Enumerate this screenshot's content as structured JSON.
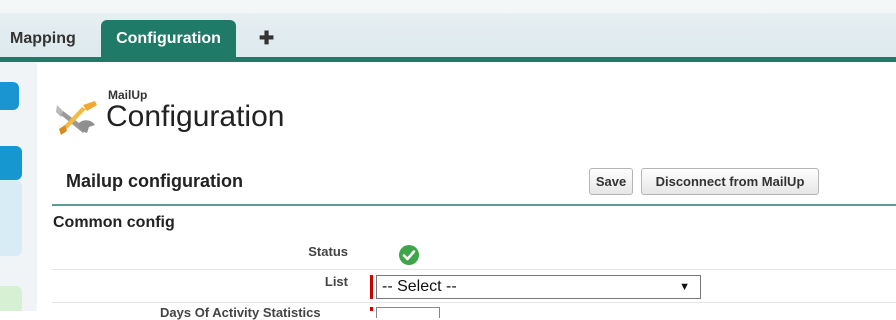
{
  "tabs": [
    {
      "label": "Mapping",
      "active": false
    },
    {
      "label": "Configuration",
      "active": true
    }
  ],
  "add_tab_symbol": "✚",
  "header": {
    "brand": "MailUp",
    "title": "Configuration",
    "logo_icon": "wrench-screwdriver-icon"
  },
  "section": {
    "title": "Mailup configuration",
    "save_label": "Save",
    "disconnect_label": "Disconnect from MailUp"
  },
  "common": {
    "title": "Common config",
    "status_label": "Status",
    "status_icon": "check-circle-icon",
    "list_label": "List",
    "list_value": "-- Select --",
    "next_label_partial": "Days Of Activity Statistics"
  },
  "colors": {
    "accent": "#1f7a67",
    "status_ok": "#3fa54a",
    "required": "#cc0000"
  }
}
